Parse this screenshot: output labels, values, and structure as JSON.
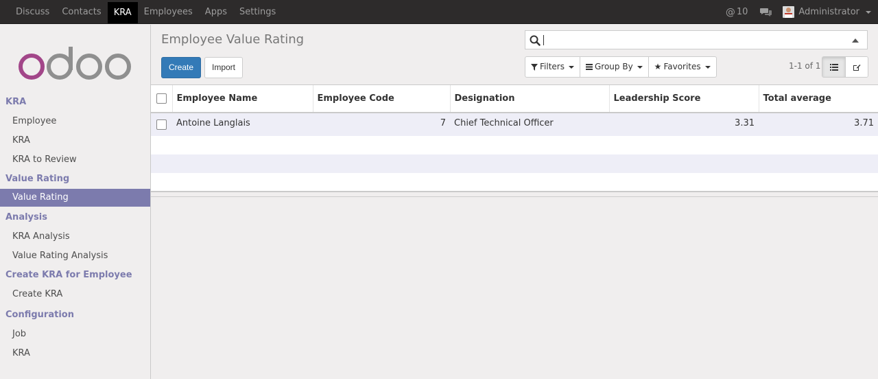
{
  "topnav": {
    "items": [
      "Discuss",
      "Contacts",
      "KRA",
      "Employees",
      "Apps",
      "Settings"
    ],
    "active": "KRA",
    "messages_count": "10",
    "user": "Administrator"
  },
  "sidebar": {
    "logo_text": "odoo",
    "sections": [
      {
        "title": "KRA",
        "links": [
          "Employee",
          "KRA",
          "KRA to Review"
        ]
      },
      {
        "title": "Value Rating",
        "links": [
          "Value Rating"
        ]
      },
      {
        "title": "Analysis",
        "links": [
          "KRA Analysis",
          "Value Rating Analysis"
        ]
      },
      {
        "title": "Create KRA for Employee",
        "links": [
          "Create KRA"
        ]
      },
      {
        "title": "Configuration",
        "links": [
          "Job",
          "KRA"
        ]
      }
    ],
    "active_link": "Value Rating"
  },
  "control": {
    "title": "Employee Value Rating",
    "create_label": "Create",
    "import_label": "Import",
    "search_value": "",
    "filters_label": "Filters",
    "groupby_label": "Group By",
    "favorites_label": "Favorites",
    "pager": "1-1 of 1"
  },
  "table": {
    "columns": [
      "Employee Name",
      "Employee Code",
      "Designation",
      "Leadership Score",
      "Total average"
    ],
    "rows": [
      [
        "Antoine Langlais",
        "7",
        "Chief Technical Officer",
        "3.31",
        "3.71"
      ]
    ]
  },
  "colors": {
    "topbar": "#2d2b2b",
    "accent": "#7c7bad",
    "primary_button": "#337ab7"
  },
  "icons": {
    "messages": "at-sign-icon",
    "chat": "comments-icon",
    "search": "search-icon",
    "filters": "filter-icon",
    "groupby": "list-bars-icon",
    "favorites": "star-icon",
    "list_view": "list-view-icon",
    "form_view": "edit-icon"
  }
}
